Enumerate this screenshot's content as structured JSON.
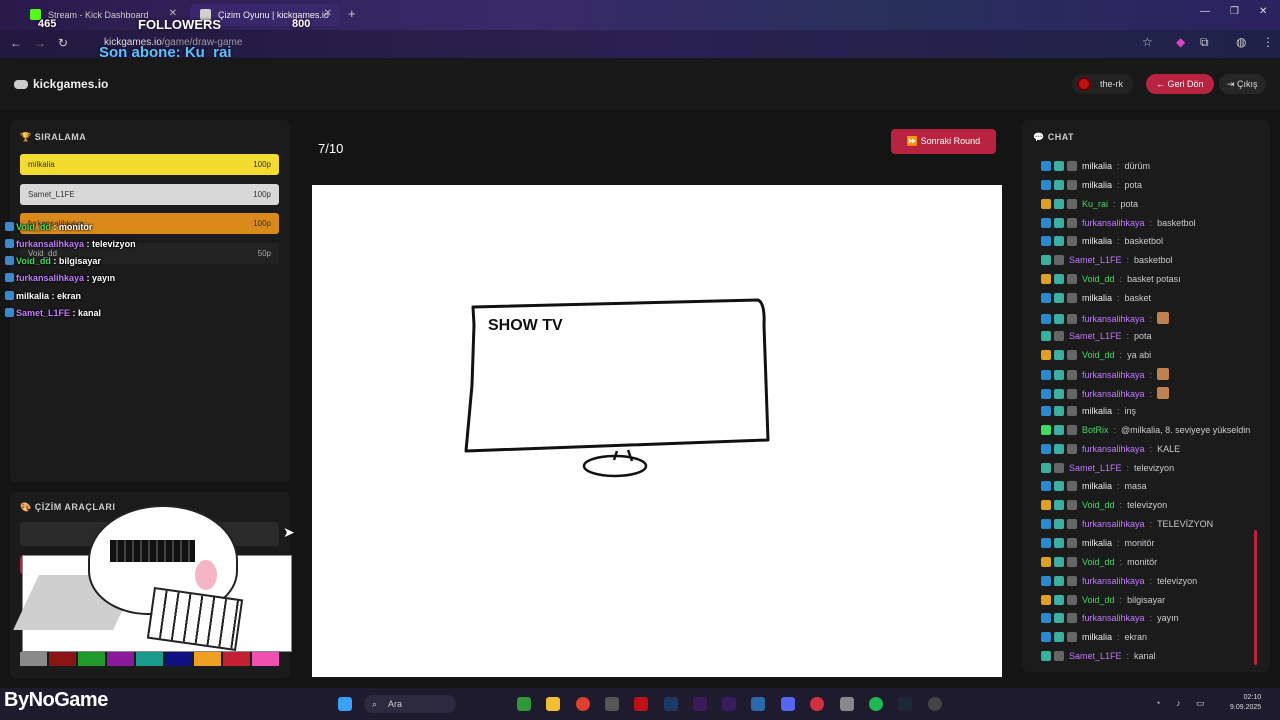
{
  "browser": {
    "tabs": [
      {
        "title": "Stream - Kick Dashboard",
        "active": false
      },
      {
        "title": "Çizim Oyunu | kickgames.io",
        "active": true
      }
    ],
    "new_tab": "+",
    "url_host": "kickgames.io",
    "url_path": "/game/draw-game",
    "nav": {
      "back": "←",
      "forward": "→",
      "reload": "↻"
    }
  },
  "stream_overlay": {
    "followers_count": "465",
    "followers_label": "FOLLOWERS",
    "followers_goal": "800",
    "last_sub": "Son abone: Ku_rai",
    "brand": "ByNoGame"
  },
  "header": {
    "logo": "kickgames.io",
    "username": "the-rk",
    "back_label": "← Geri Dön",
    "exit_label": "Çıkış"
  },
  "ranking": {
    "title": "SIRALAMA",
    "rows": [
      {
        "name": "milkalia",
        "points": "100p",
        "color": "#f2dc2e"
      },
      {
        "name": "Samet_L1FE",
        "points": "100p",
        "color": "#d8d8d8"
      },
      {
        "name": "furkansalihkaya",
        "points": "100p",
        "color": "#d98a1a"
      },
      {
        "name": "Void_dd",
        "points": "50p",
        "color": "#222222"
      }
    ]
  },
  "overlay_chat": [
    {
      "user": "Void_dd",
      "msg": "monitör",
      "color": "#3ddc60"
    },
    {
      "user": "furkansalihkaya",
      "msg": "televizyon",
      "color": "#c27aff"
    },
    {
      "user": "Void_dd",
      "msg": "bilgisayar",
      "color": "#3ddc60"
    },
    {
      "user": "furkansalihkaya",
      "msg": "yayın",
      "color": "#c27aff"
    },
    {
      "user": "milkalia",
      "msg": "ekran",
      "color": "#ffffff"
    },
    {
      "user": "Samet_L1FE",
      "msg": "kanal",
      "color": "#c27aff"
    }
  ],
  "tools": {
    "title": "ÇİZİM ARAÇLARI",
    "colors": [
      "#8a8a8a",
      "#8b1414",
      "#1f9a2a",
      "#8a1a9a",
      "#1a9a8a",
      "#101080",
      "#f0a020",
      "#c02030",
      "#f050b0"
    ]
  },
  "game": {
    "round_label": "7/10",
    "next_round_label": "Sonraki Round",
    "drawing_text": "SHOW TV"
  },
  "chat": {
    "title": "CHAT",
    "messages": [
      {
        "user": "milkalia",
        "msg": "dürüm",
        "color": "#e8e8e8",
        "badges": "sub"
      },
      {
        "user": "milkalia",
        "msg": "pota",
        "color": "#e8e8e8",
        "badges": "sub"
      },
      {
        "user": "Ku_rai",
        "msg": "pota",
        "color": "#3ddc60",
        "badges": "gold"
      },
      {
        "user": "furkansalihkaya",
        "msg": "basketbol",
        "color": "#c27aff",
        "badges": "sub"
      },
      {
        "user": "milkalia",
        "msg": "basketbol",
        "color": "#e8e8e8",
        "badges": "sub"
      },
      {
        "user": "Samet_L1FE",
        "msg": "basketbol",
        "color": "#c27aff",
        "badges": "plain"
      },
      {
        "user": "Void_dd",
        "msg": "basket potası",
        "color": "#3ddc60",
        "badges": "gold"
      },
      {
        "user": "milkalia",
        "msg": "basket",
        "color": "#e8e8e8",
        "badges": "sub"
      },
      {
        "user": "furkansalihkaya",
        "msg": "",
        "color": "#c27aff",
        "badges": "sub"
      },
      {
        "user": "Samet_L1FE",
        "msg": "pota",
        "color": "#c27aff",
        "badges": "plain"
      },
      {
        "user": "Void_dd",
        "msg": "ya abi",
        "color": "#3ddc60",
        "badges": "gold"
      },
      {
        "user": "furkansalihkaya",
        "msg": "",
        "color": "#c27aff",
        "badges": "sub"
      },
      {
        "user": "furkansalihkaya",
        "msg": "",
        "color": "#c27aff",
        "badges": "sub"
      },
      {
        "user": "milkalia",
        "msg": "inş",
        "color": "#e8e8e8",
        "badges": "sub"
      },
      {
        "user": "BotRix",
        "msg": "@milkalia, 8. seviyeye yükseldin",
        "color": "#3ddc60",
        "badges": "bot"
      },
      {
        "user": "furkansalihkaya",
        "msg": "KALE",
        "color": "#c27aff",
        "badges": "sub"
      },
      {
        "user": "Samet_L1FE",
        "msg": "televizyon",
        "color": "#c27aff",
        "badges": "plain"
      },
      {
        "user": "milkalia",
        "msg": "masa",
        "color": "#e8e8e8",
        "badges": "sub"
      },
      {
        "user": "Void_dd",
        "msg": "televizyon",
        "color": "#3ddc60",
        "badges": "gold"
      },
      {
        "user": "furkansalihkaya",
        "msg": "TELEVİZYON",
        "color": "#c27aff",
        "badges": "sub"
      },
      {
        "user": "milkalia",
        "msg": "monitör",
        "color": "#e8e8e8",
        "badges": "sub"
      },
      {
        "user": "Void_dd",
        "msg": "monitör",
        "color": "#3ddc60",
        "badges": "gold"
      },
      {
        "user": "furkansalihkaya",
        "msg": "televizyon",
        "color": "#c27aff",
        "badges": "sub"
      },
      {
        "user": "Void_dd",
        "msg": "bilgisayar",
        "color": "#3ddc60",
        "badges": "gold"
      },
      {
        "user": "furkansalihkaya",
        "msg": "yayın",
        "color": "#c27aff",
        "badges": "sub"
      },
      {
        "user": "milkalia",
        "msg": "ekran",
        "color": "#e8e8e8",
        "badges": "sub"
      },
      {
        "user": "Samet_L1FE",
        "msg": "kanal",
        "color": "#c27aff",
        "badges": "plain"
      }
    ]
  },
  "taskbar": {
    "search_label": "Ara",
    "time": "02:10",
    "date": "9.09.2025"
  }
}
